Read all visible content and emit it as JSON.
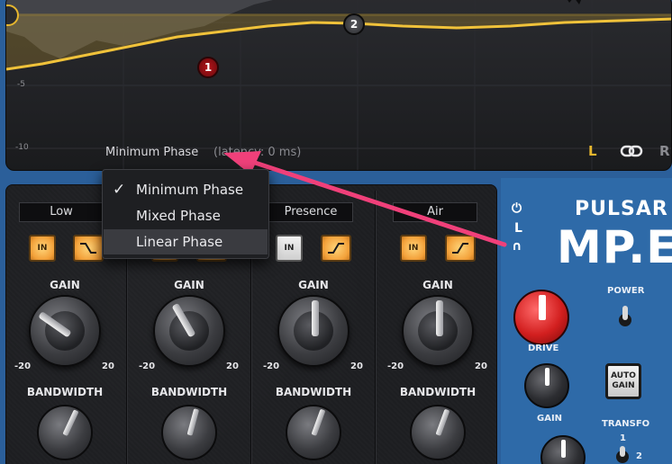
{
  "display": {
    "scale_labels": [
      "-5",
      "-10"
    ],
    "nodes": [
      "1",
      "2"
    ],
    "phase_mode": "Minimum Phase",
    "latency": "(latency: 0 ms)",
    "channel_left": "L",
    "channel_right": "R",
    "icons": [
      "link-icon"
    ]
  },
  "phase_menu": {
    "selected": "Minimum Phase",
    "items": [
      "Minimum Phase",
      "Mixed Phase",
      "Linear Phase"
    ],
    "highlighted": "Linear Phase"
  },
  "bands": [
    {
      "name": "Low",
      "in": "IN",
      "gain_label": "GAIN",
      "min": "-20",
      "max": "20",
      "bw_label": "BANDWIDTH"
    },
    {
      "name": "",
      "in": "IN",
      "gain_label": "GAIN",
      "min": "-20",
      "max": "20",
      "bw_label": "BANDWIDTH"
    },
    {
      "name": "Presence",
      "in": "IN",
      "gain_label": "GAIN",
      "min": "-20",
      "max": "20",
      "bw_label": "BANDWIDTH"
    },
    {
      "name": "Air",
      "in": "IN",
      "gain_label": "GAIN",
      "min": "-20",
      "max": "20",
      "bw_label": "BANDWIDTH"
    }
  ],
  "right_panel": {
    "brand": "PULSAR",
    "model": "MP.EQ",
    "side_l": "L",
    "power_label": "POWER",
    "drive_label": "DRIVE",
    "gain_label": "GAIN",
    "auto_gain_line1": "AUTO",
    "auto_gain_line2": "GAIN",
    "transfo_label": "TRANSFO",
    "transfo_pos1": "1",
    "transfo_pos2": "2"
  },
  "colors": {
    "accent": "#e6b62e",
    "panel_blue": "#2e6aa8",
    "annotation_arrow": "#f0407a"
  }
}
